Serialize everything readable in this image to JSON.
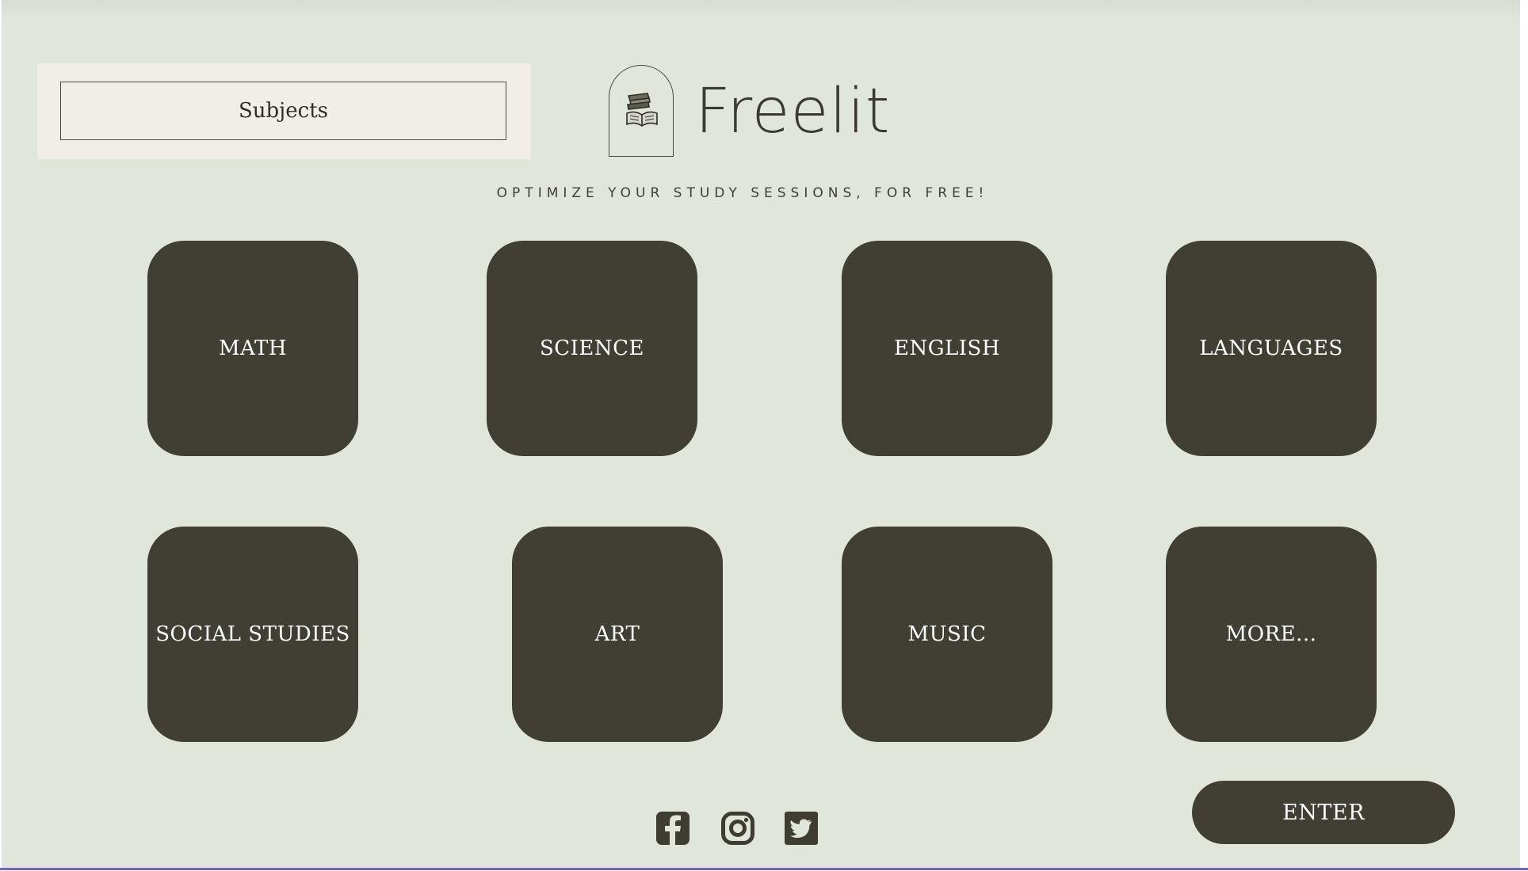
{
  "app": {
    "brand_name": "Freelit",
    "tagline": "OPTIMIZE YOUR STUDY SESSIONS, FOR FREE!",
    "logo_icon": "books-icon"
  },
  "subjects_box": {
    "label": "Subjects"
  },
  "tiles": [
    {
      "label": "MATH"
    },
    {
      "label": "SCIENCE"
    },
    {
      "label": "ENGLISH"
    },
    {
      "label": "LANGUAGES"
    },
    {
      "label": "SOCIAL STUDIES"
    },
    {
      "label": "ART"
    },
    {
      "label": "MUSIC"
    },
    {
      "label": "MORE..."
    }
  ],
  "social": [
    {
      "icon": "facebook-icon"
    },
    {
      "icon": "instagram-icon"
    },
    {
      "icon": "twitter-icon"
    }
  ],
  "enter_button": {
    "label": "ENTER"
  },
  "colors": {
    "background": "#e1e6da",
    "tile": "#413f33",
    "panel": "#f1ede8",
    "text_dark": "#3a3a33",
    "bottom_line": "#7c5ec9"
  }
}
